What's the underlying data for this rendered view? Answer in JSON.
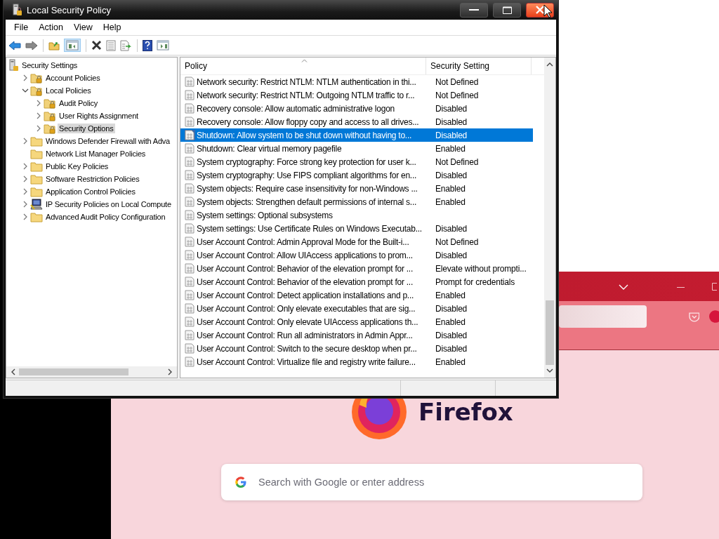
{
  "window": {
    "title": "Local Security Policy"
  },
  "menu": [
    {
      "label": "File"
    },
    {
      "label": "Action"
    },
    {
      "label": "View"
    },
    {
      "label": "Help"
    }
  ],
  "tree": {
    "root": "Security Settings",
    "items": [
      {
        "label": "Account Policies",
        "kind": "locked-folder",
        "expanded": false,
        "selected": false
      },
      {
        "label": "Local Policies",
        "kind": "locked-folder",
        "expanded": true,
        "selected": false,
        "children": [
          {
            "label": "Audit Policy",
            "kind": "locked-folder",
            "expanded": false,
            "selected": false
          },
          {
            "label": "User Rights Assignment",
            "kind": "locked-folder",
            "expanded": false,
            "selected": false
          },
          {
            "label": "Security Options",
            "kind": "locked-folder",
            "expanded": false,
            "selected": true
          }
        ]
      },
      {
        "label": "Windows Defender Firewall with Adva",
        "kind": "folder",
        "expanded": false,
        "selected": false
      },
      {
        "label": "Network List Manager Policies",
        "kind": "leaf-folder",
        "selected": false
      },
      {
        "label": "Public Key Policies",
        "kind": "folder",
        "expanded": false,
        "selected": false
      },
      {
        "label": "Software Restriction Policies",
        "kind": "folder",
        "expanded": false,
        "selected": false
      },
      {
        "label": "Application Control Policies",
        "kind": "folder",
        "expanded": false,
        "selected": false
      },
      {
        "label": "IP Security Policies on Local Compute",
        "kind": "computer",
        "expanded": false,
        "selected": false
      },
      {
        "label": "Advanced Audit Policy Configuration",
        "kind": "folder",
        "expanded": false,
        "selected": false
      }
    ]
  },
  "list": {
    "columns": [
      "Policy",
      "Security Setting"
    ],
    "rows": [
      {
        "policy": "Network security: Restrict NTLM: NTLM authentication in thi...",
        "setting": "Not Defined",
        "selected": false
      },
      {
        "policy": "Network security: Restrict NTLM: Outgoing NTLM traffic to r...",
        "setting": "Not Defined",
        "selected": false
      },
      {
        "policy": "Recovery console: Allow automatic administrative logon",
        "setting": "Disabled",
        "selected": false
      },
      {
        "policy": "Recovery console: Allow floppy copy and access to all drives...",
        "setting": "Disabled",
        "selected": false
      },
      {
        "policy": "Shutdown: Allow system to be shut down without having to...",
        "setting": "Disabled",
        "selected": true
      },
      {
        "policy": "Shutdown: Clear virtual memory pagefile",
        "setting": "Enabled",
        "selected": false
      },
      {
        "policy": "System cryptography: Force strong key protection for user k...",
        "setting": "Not Defined",
        "selected": false
      },
      {
        "policy": "System cryptography: Use FIPS compliant algorithms for en...",
        "setting": "Disabled",
        "selected": false
      },
      {
        "policy": "System objects: Require case insensitivity for non-Windows ...",
        "setting": "Enabled",
        "selected": false
      },
      {
        "policy": "System objects: Strengthen default permissions of internal s...",
        "setting": "Enabled",
        "selected": false
      },
      {
        "policy": "System settings: Optional subsystems",
        "selected": false
      },
      {
        "policy": "System settings: Use Certificate Rules on Windows Executab...",
        "setting": "Disabled",
        "selected": false
      },
      {
        "policy": "User Account Control: Admin Approval Mode for the Built-i...",
        "setting": "Not Defined",
        "selected": false
      },
      {
        "policy": "User Account Control: Allow UIAccess applications to prom...",
        "setting": "Disabled",
        "selected": false
      },
      {
        "policy": "User Account Control: Behavior of the elevation prompt for ...",
        "setting": "Elevate without prompti...",
        "selected": false
      },
      {
        "policy": "User Account Control: Behavior of the elevation prompt for ...",
        "setting": "Prompt for credentials",
        "selected": false
      },
      {
        "policy": "User Account Control: Detect application installations and p...",
        "setting": "Enabled",
        "selected": false
      },
      {
        "policy": "User Account Control: Only elevate executables that are sig...",
        "setting": "Disabled",
        "selected": false
      },
      {
        "policy": "User Account Control: Only elevate UIAccess applications th...",
        "setting": "Enabled",
        "selected": false
      },
      {
        "policy": "User Account Control: Run all administrators in Admin Appr...",
        "setting": "Disabled",
        "selected": false
      },
      {
        "policy": "User Account Control: Switch to the secure desktop when pr...",
        "setting": "Disabled",
        "selected": false
      },
      {
        "policy": "User Account Control: Virtualize file and registry write failure...",
        "setting": "Enabled",
        "selected": false
      }
    ]
  },
  "browser": {
    "wordmark": "Firefox",
    "search": {
      "placeholder": "Search with Google or enter address"
    }
  }
}
